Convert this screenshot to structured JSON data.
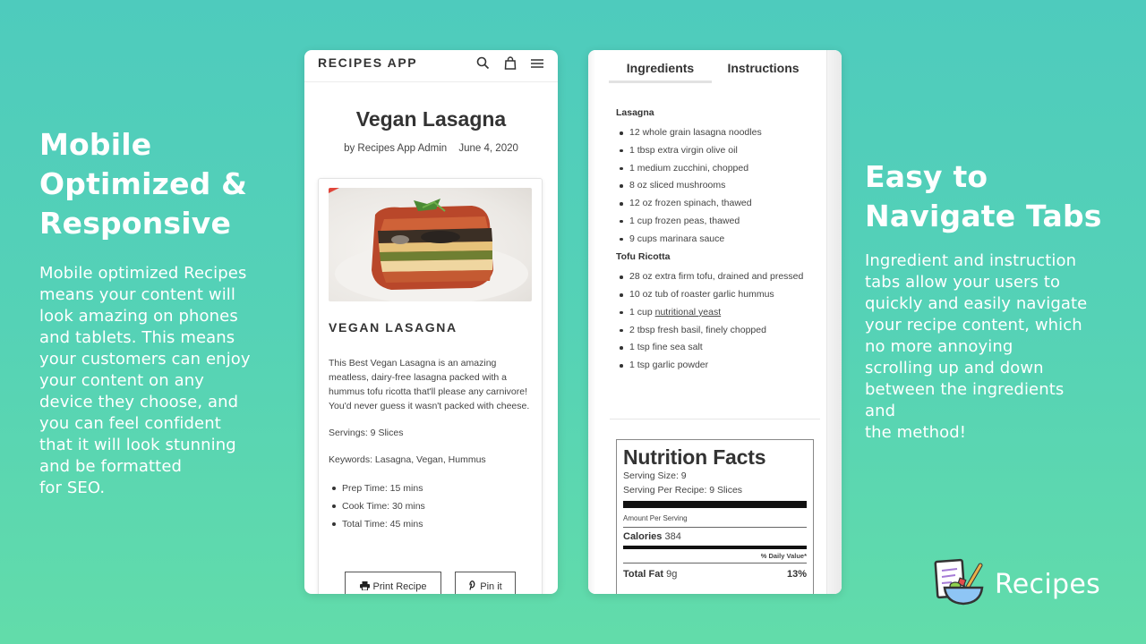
{
  "promo_left": {
    "heading": "Mobile Optimized & Responsive",
    "body": "Mobile optimized Recipes\nmeans your content will\nlook amazing on phones\nand tablets. This means\nyour customers can enjoy\nyour content on any\ndevice they choose, and\nyou can feel confident\nthat it will look stunning\nand be formatted\nfor SEO."
  },
  "promo_right": {
    "heading": "Easy to Navigate Tabs",
    "body": "Ingredient and instruction\ntabs allow your users to\nquickly and easily navigate\nyour recipe content, which\nno more annoying\nscrolling up and down\nbetween the ingredients\nand\nthe method!"
  },
  "phone1": {
    "app_title": "RECIPES APP",
    "icons": [
      "search-icon",
      "shopping-bag-icon",
      "menu-icon"
    ],
    "recipe_title": "Vegan Lasagna",
    "author": "by Recipes App Admin",
    "date": "June 4, 2020",
    "card": {
      "heading": "VEGAN LASAGNA",
      "description": "This Best Vegan Lasagna is an amazing meatless, dairy-free lasagna packed with a hummus tofu ricotta that'll please any carnivore! You'd never guess it wasn't packed with cheese.",
      "servings": "Servings: 9 Slices",
      "keywords": "Keywords: Lasagna, Vegan, Hummus",
      "times": [
        "Prep Time: 15 mins",
        "Cook Time: 30 mins",
        "Total Time: 45 mins"
      ],
      "print_label": "Print Recipe",
      "pin_label": "Pin it"
    }
  },
  "phone2": {
    "tabs": [
      {
        "label": "Ingredients",
        "active": true
      },
      {
        "label": "Instructions",
        "active": false
      }
    ],
    "groups": [
      {
        "title": "Lasagna",
        "items": [
          "12 whole grain lasagna noodles",
          "1 tbsp extra virgin olive oil",
          "1 medium zucchini, chopped",
          "8 oz sliced mushrooms",
          "12 oz frozen spinach, thawed",
          "1 cup frozen peas, thawed",
          "9 cups marinara sauce"
        ]
      },
      {
        "title": "Tofu Ricotta",
        "items": [
          "28 oz extra firm tofu, drained and pressed",
          "10 oz tub of roaster garlic hummus",
          "1 cup nutritional yeast",
          "2 tbsp fresh basil, finely chopped",
          "1 tsp fine sea salt",
          "1 tsp garlic powder"
        ]
      }
    ],
    "linked_item": {
      "prefix": "1 cup ",
      "link": "nutritional yeast"
    },
    "nutrition": {
      "title": "Nutrition Facts",
      "serving_size": "Serving Size: 9",
      "servings_per_recipe": "Serving Per Recipe: 9 Slices",
      "amount_per_serving": "Amount Per Serving",
      "calories_label": "Calories",
      "calories_value": "384",
      "daily_value_header": "% Daily Value*",
      "total_fat_label": "Total Fat",
      "total_fat_value": "9g",
      "total_fat_dv": "13%"
    }
  },
  "logo": {
    "text": "Recipes",
    "icon": "recipe-bowl-icon"
  }
}
